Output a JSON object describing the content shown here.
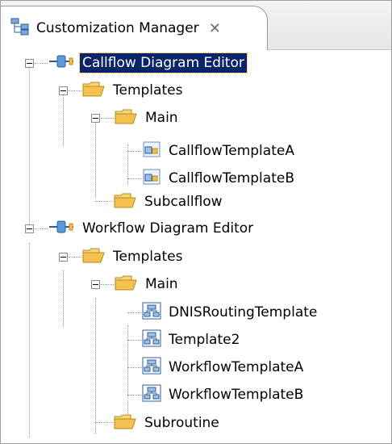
{
  "view": {
    "title": "Customization Manager",
    "close_symbol": "✕"
  },
  "tree": {
    "callflow_editor": "Callflow Diagram Editor",
    "callflow_templates": "Templates",
    "callflow_main": "Main",
    "callflow_template_a": "CallflowTemplateA",
    "callflow_template_b": "CallflowTemplateB",
    "subcallflow": "Subcallflow",
    "workflow_editor": "Workflow Diagram Editor",
    "workflow_templates": "Templates",
    "workflow_main": "Main",
    "dnis_template": "DNISRoutingTemplate",
    "template2": "Template2",
    "workflow_template_a": "WorkflowTemplateA",
    "workflow_template_b": "WorkflowTemplateB",
    "subroutine": "Subroutine"
  },
  "colors": {
    "selection_bg": "#0a246a",
    "folder": "#f2c14e"
  },
  "icons": {
    "view_icon": "tree-view-icon",
    "editor_icon": "plugin-icon",
    "folder_icon": "folder-open-icon",
    "callflow_file_icon": "callflow-file-icon",
    "workflow_file_icon": "workflow-file-icon"
  }
}
